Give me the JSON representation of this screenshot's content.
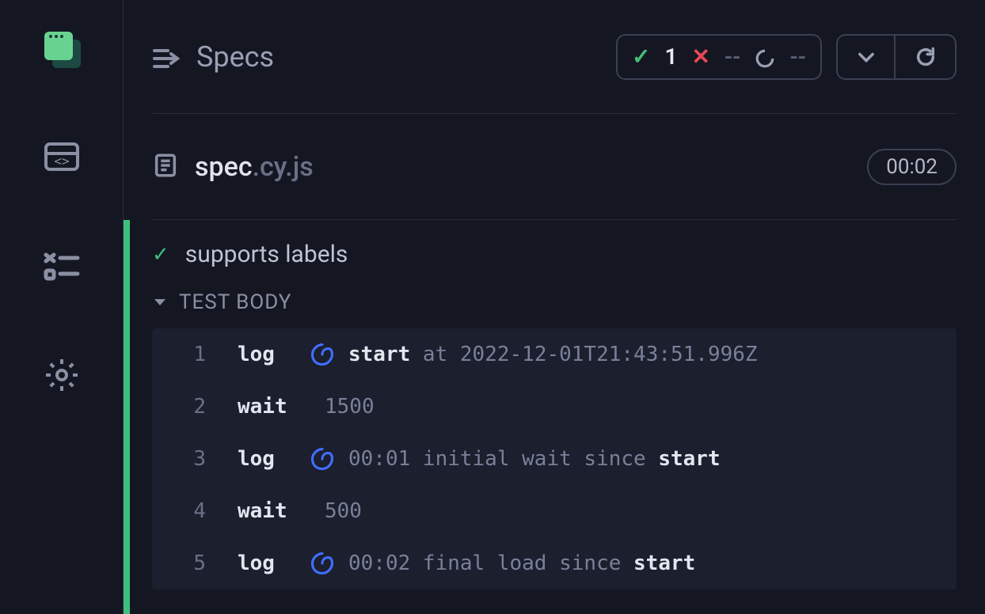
{
  "header": {
    "title": "Specs",
    "pass_count": "1",
    "fail_placeholder": "--",
    "pending_placeholder": "--"
  },
  "file": {
    "basename": "spec",
    "ext": ".cy.js",
    "timer": "00:02"
  },
  "test": {
    "title": "supports labels",
    "section_label": "TEST BODY"
  },
  "log_rows": [
    {
      "n": "1",
      "cmd": "log",
      "spiral": true,
      "parts": [
        {
          "t": "start",
          "b": true
        },
        {
          "t": " at 2022-12-01T21:43:51.996Z",
          "b": false
        }
      ]
    },
    {
      "n": "2",
      "cmd": "wait",
      "spiral": false,
      "parts": [
        {
          "t": "1500",
          "b": false
        }
      ]
    },
    {
      "n": "3",
      "cmd": "log",
      "spiral": true,
      "parts": [
        {
          "t": "00:01 initial wait since ",
          "b": false
        },
        {
          "t": "start",
          "b": true
        }
      ]
    },
    {
      "n": "4",
      "cmd": "wait",
      "spiral": false,
      "parts": [
        {
          "t": "500",
          "b": false
        }
      ]
    },
    {
      "n": "5",
      "cmd": "log",
      "spiral": true,
      "parts": [
        {
          "t": "00:02 final load since ",
          "b": false
        },
        {
          "t": "start",
          "b": true
        }
      ]
    }
  ]
}
